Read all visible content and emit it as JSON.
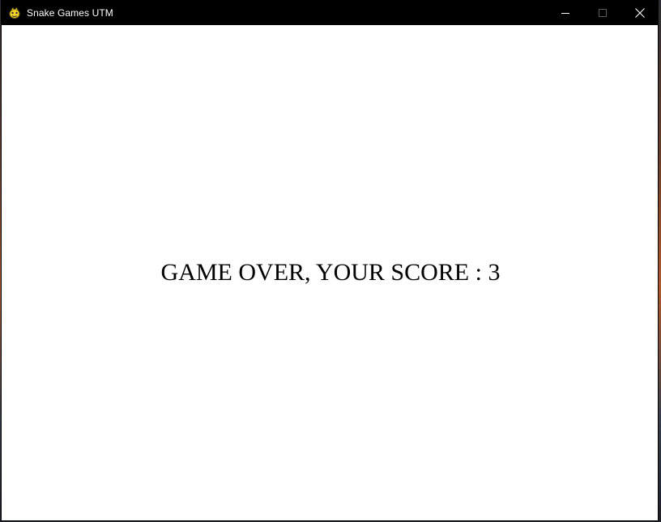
{
  "window": {
    "title": "Snake Games UTM",
    "icon": "pygame-snake-icon"
  },
  "controls": {
    "minimize_icon": "minimize-icon",
    "maximize_icon": "maximize-icon",
    "close_icon": "close-icon"
  },
  "game": {
    "message": "GAME OVER, YOUR SCORE : 3",
    "background_color": "#ffffff",
    "text_color": "#000000"
  }
}
